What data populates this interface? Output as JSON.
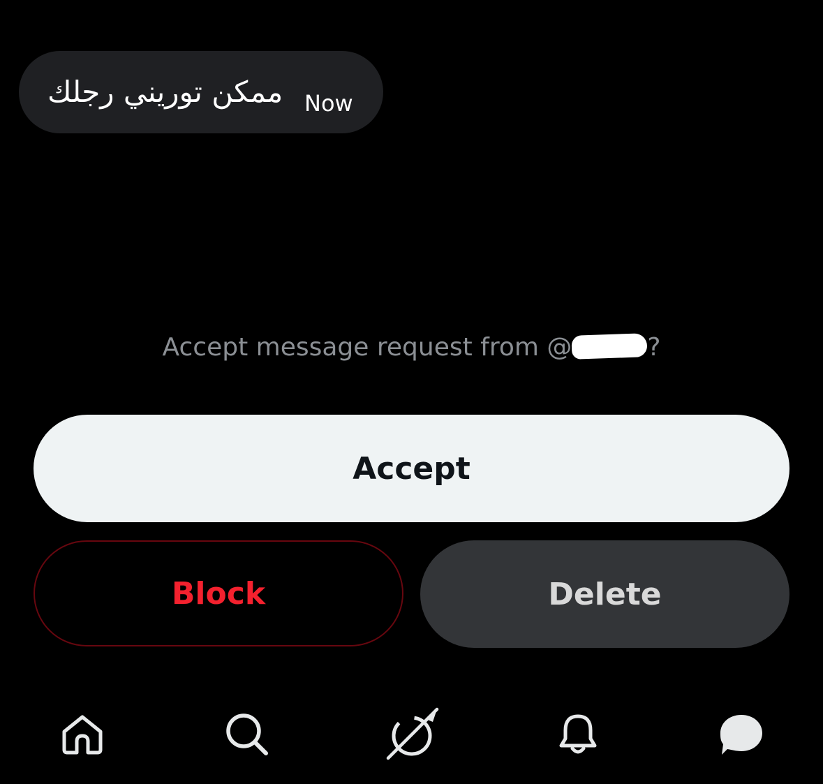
{
  "message": {
    "text": "ممكن توريني رجلك",
    "time": "Now"
  },
  "request": {
    "prompt_prefix": "Accept message request from @",
    "prompt_suffix": "?"
  },
  "actions": {
    "accept_label": "Accept",
    "block_label": "Block",
    "delete_label": "Delete"
  },
  "nav": {
    "items": [
      {
        "icon": "home-icon"
      },
      {
        "icon": "search-icon"
      },
      {
        "icon": "grok-icon"
      },
      {
        "icon": "bell-icon"
      },
      {
        "icon": "messages-icon"
      }
    ]
  },
  "colors": {
    "background": "#000000",
    "bubble": "#1f2023",
    "accept_bg": "#eff3f4",
    "block_text": "#f4212e",
    "delete_bg": "#333538"
  }
}
